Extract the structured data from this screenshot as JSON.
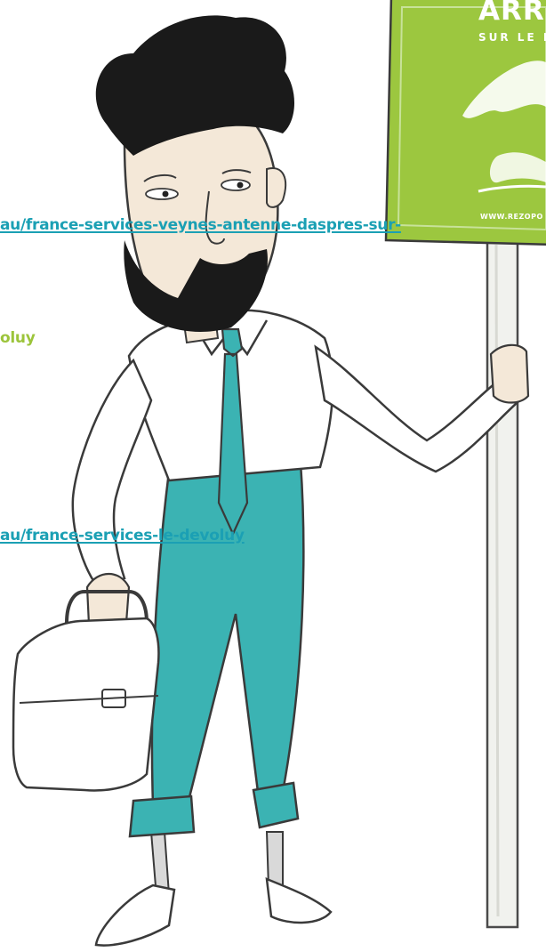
{
  "links": [
    {
      "text": "au/france-services-veynes-antenne-daspres-sur-"
    },
    {
      "text": "au/france-services-le-devoluy"
    }
  ],
  "heading": {
    "text": "oluy"
  },
  "sign": {
    "title": "ARRE",
    "subtitle": "SUR LE R",
    "url": "WWW.REZOPO"
  },
  "colors": {
    "link": "#1ba0b4",
    "heading": "#9cc43b",
    "sign_green": "#9cc73f",
    "tie_and_pants": "#3bb3b3",
    "hair_beard": "#1a1a1a"
  },
  "icons": {
    "illustration": "businessman-with-briefcase-holding-sign",
    "briefcase": "briefcase-icon"
  }
}
